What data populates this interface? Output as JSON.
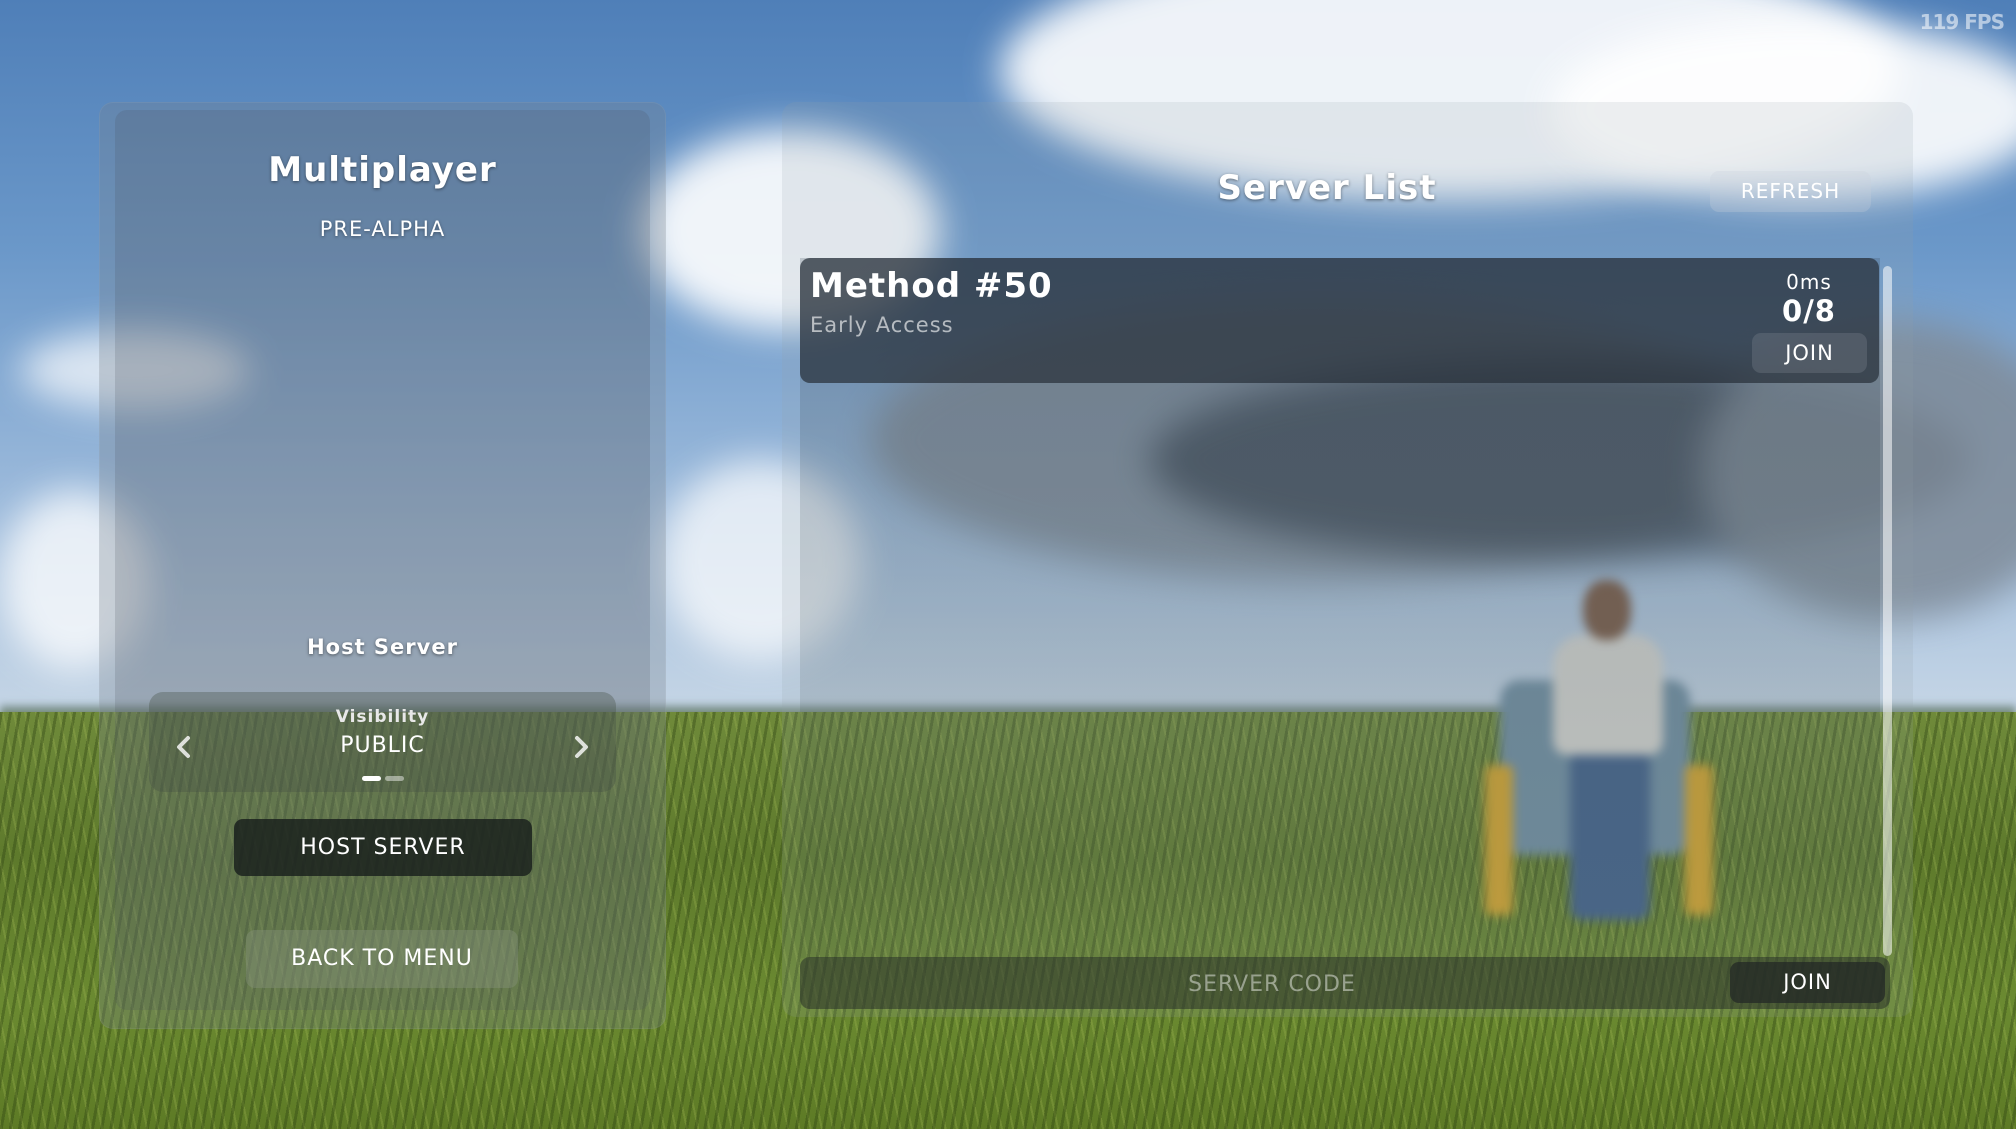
{
  "hud": {
    "fps": "119 FPS"
  },
  "multiplayer": {
    "title": "Multiplayer",
    "subtitle": "PRE-ALPHA",
    "host_heading": "Host Server",
    "visibility": {
      "label": "Visibility",
      "value": "PUBLIC",
      "left_arrow_icon": "chevron-left-icon",
      "right_arrow_icon": "chevron-right-icon",
      "option_count": 2,
      "selected_index": 0
    },
    "host_button": "HOST SERVER",
    "back_button": "BACK TO MENU"
  },
  "server_list": {
    "title": "Server List",
    "refresh_button": "REFRESH",
    "servers": [
      {
        "name": "Method #50",
        "description": "Early Access",
        "ping": "0ms",
        "players": "0/8",
        "join_label": "JOIN"
      }
    ],
    "code_placeholder": "SERVER CODE",
    "code_value": "",
    "code_join_button": "JOIN"
  }
}
